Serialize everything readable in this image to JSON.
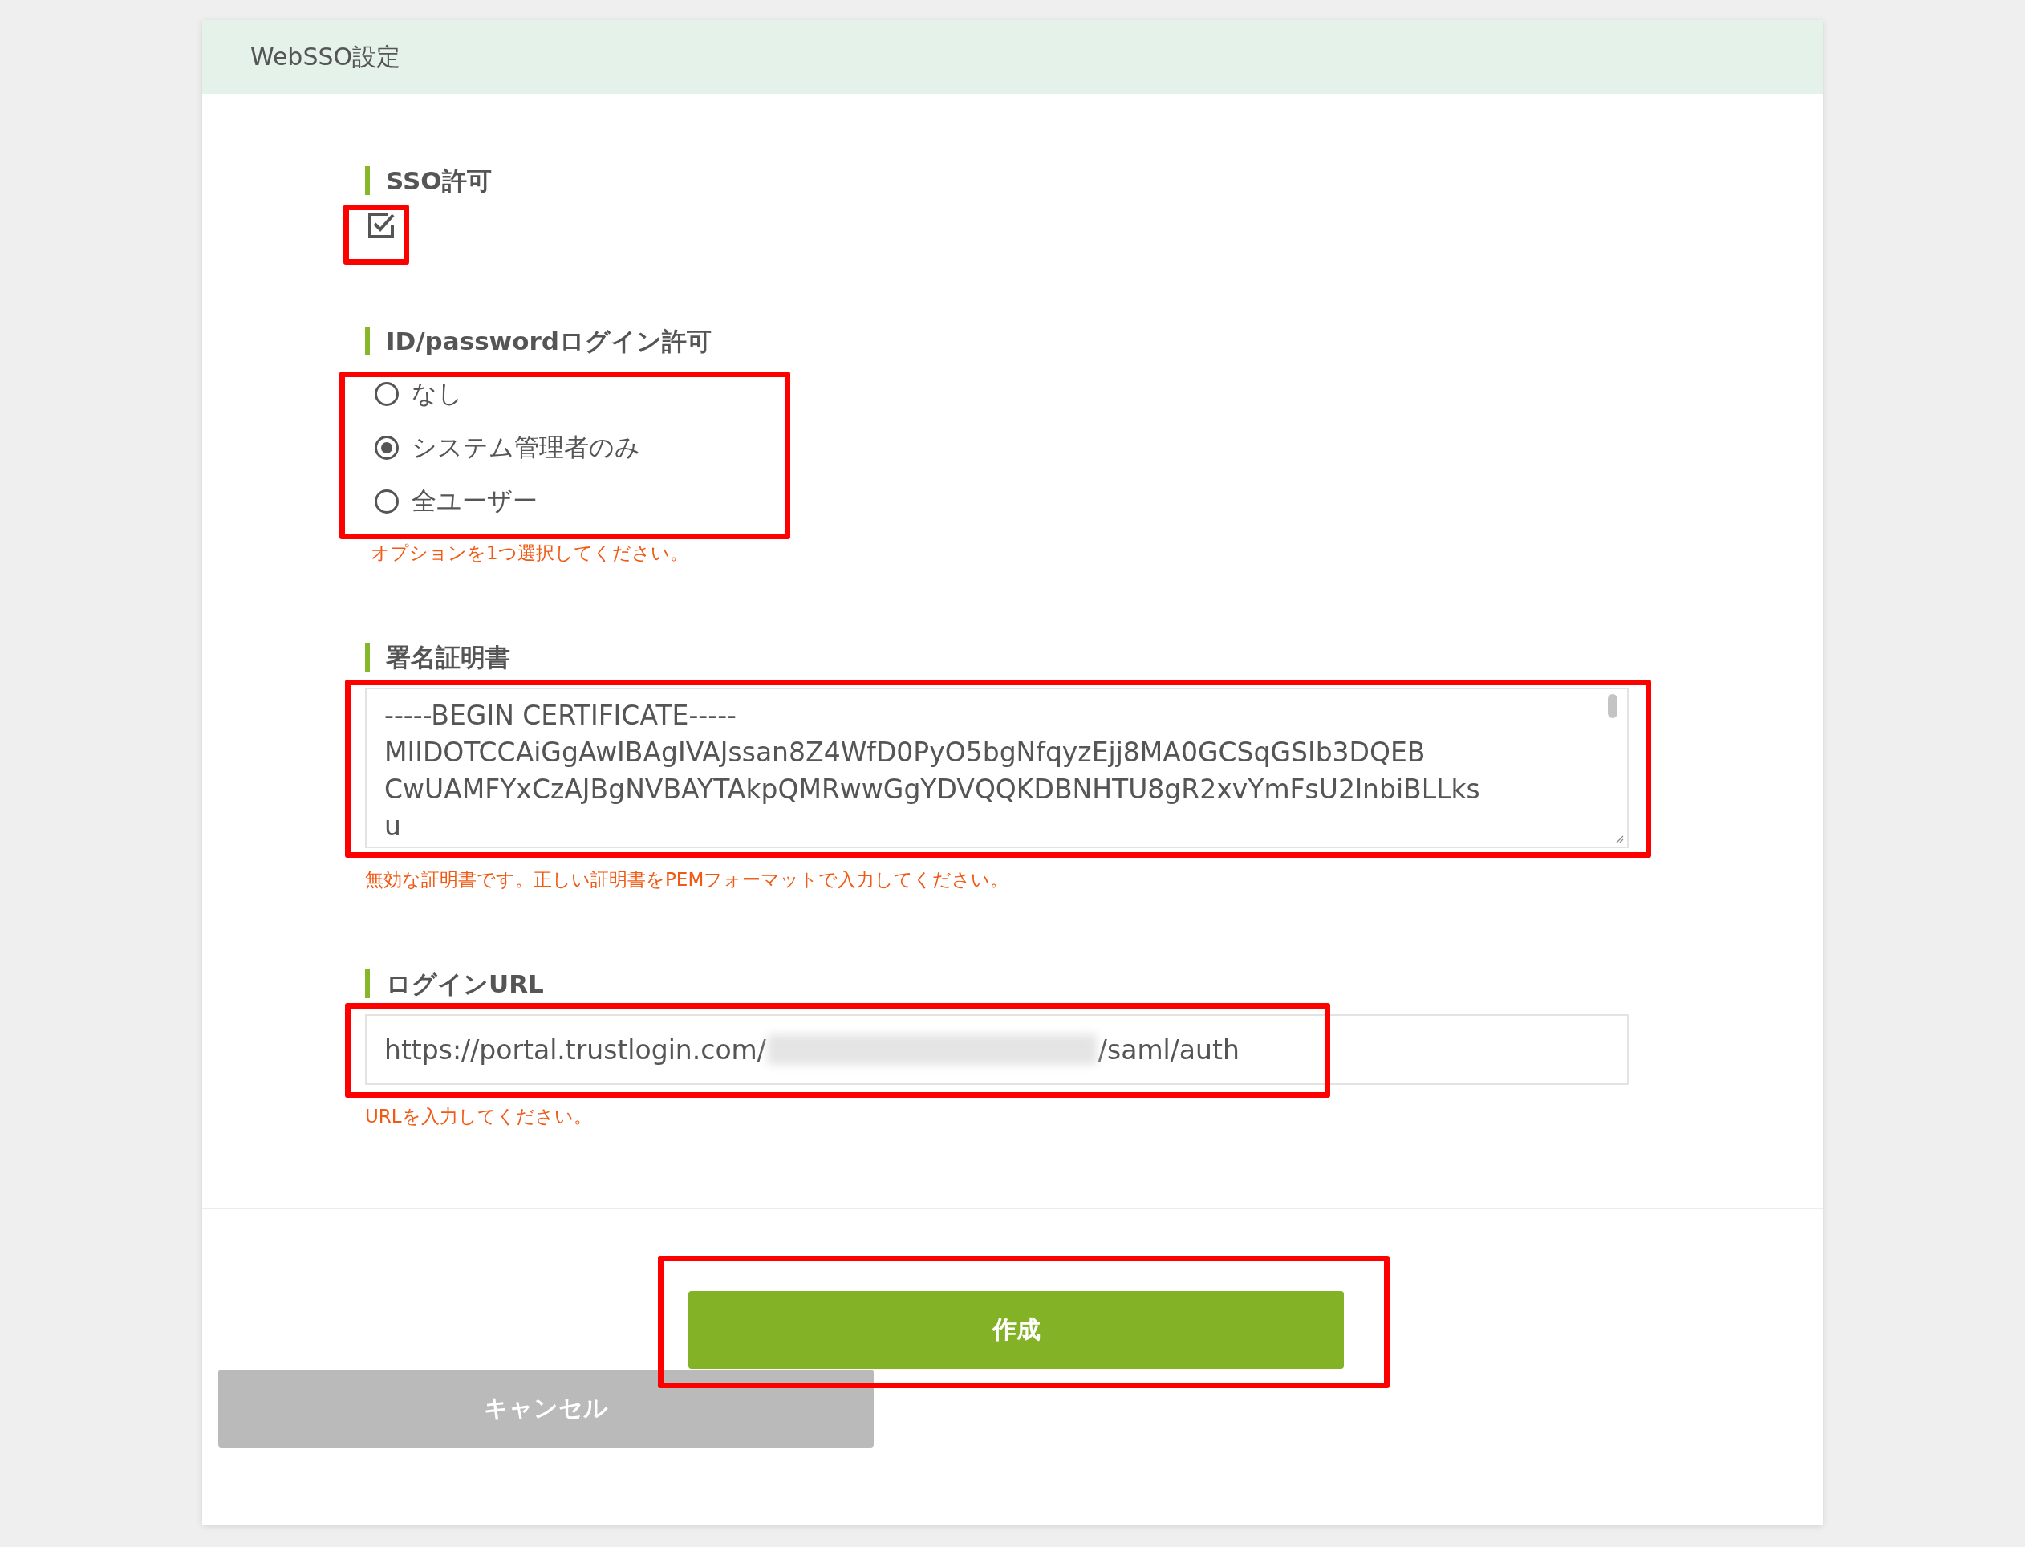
{
  "panel": {
    "title": "WebSSO設定"
  },
  "sso": {
    "label": "SSO許可",
    "checked": true
  },
  "login": {
    "label": "ID/passwordログイン許可",
    "options": [
      {
        "label": "なし",
        "selected": false
      },
      {
        "label": "システム管理者のみ",
        "selected": true
      },
      {
        "label": "全ユーザー",
        "selected": false
      }
    ],
    "error": "オプションを1つ選択してください。"
  },
  "certificate": {
    "label": "署名証明書",
    "value": "-----BEGIN CERTIFICATE-----\nMIIDOTCCAiGgAwIBAgIVAJssan8Z4WfD0PyO5bgNfqyzEjj8MA0GCSqGSIb3DQEB\nCwUAMFYxCzAJBgNVBAYTAkpQMRwwGgYDVQQKDBNHTU8gR2xvYmFsU2lnbiBLLks\nu",
    "error": "無効な証明書です。正しい証明書をPEMフォーマットで入力してください。"
  },
  "login_url": {
    "label": "ログインURL",
    "value_start": "https://portal.trustlogin.com/",
    "value_end": "/saml/auth",
    "error": "URLを入力してください。"
  },
  "buttons": [
    {
      "label": "作成",
      "kind": "primary"
    },
    {
      "label": "キャンセル",
      "kind": "cancel"
    }
  ]
}
